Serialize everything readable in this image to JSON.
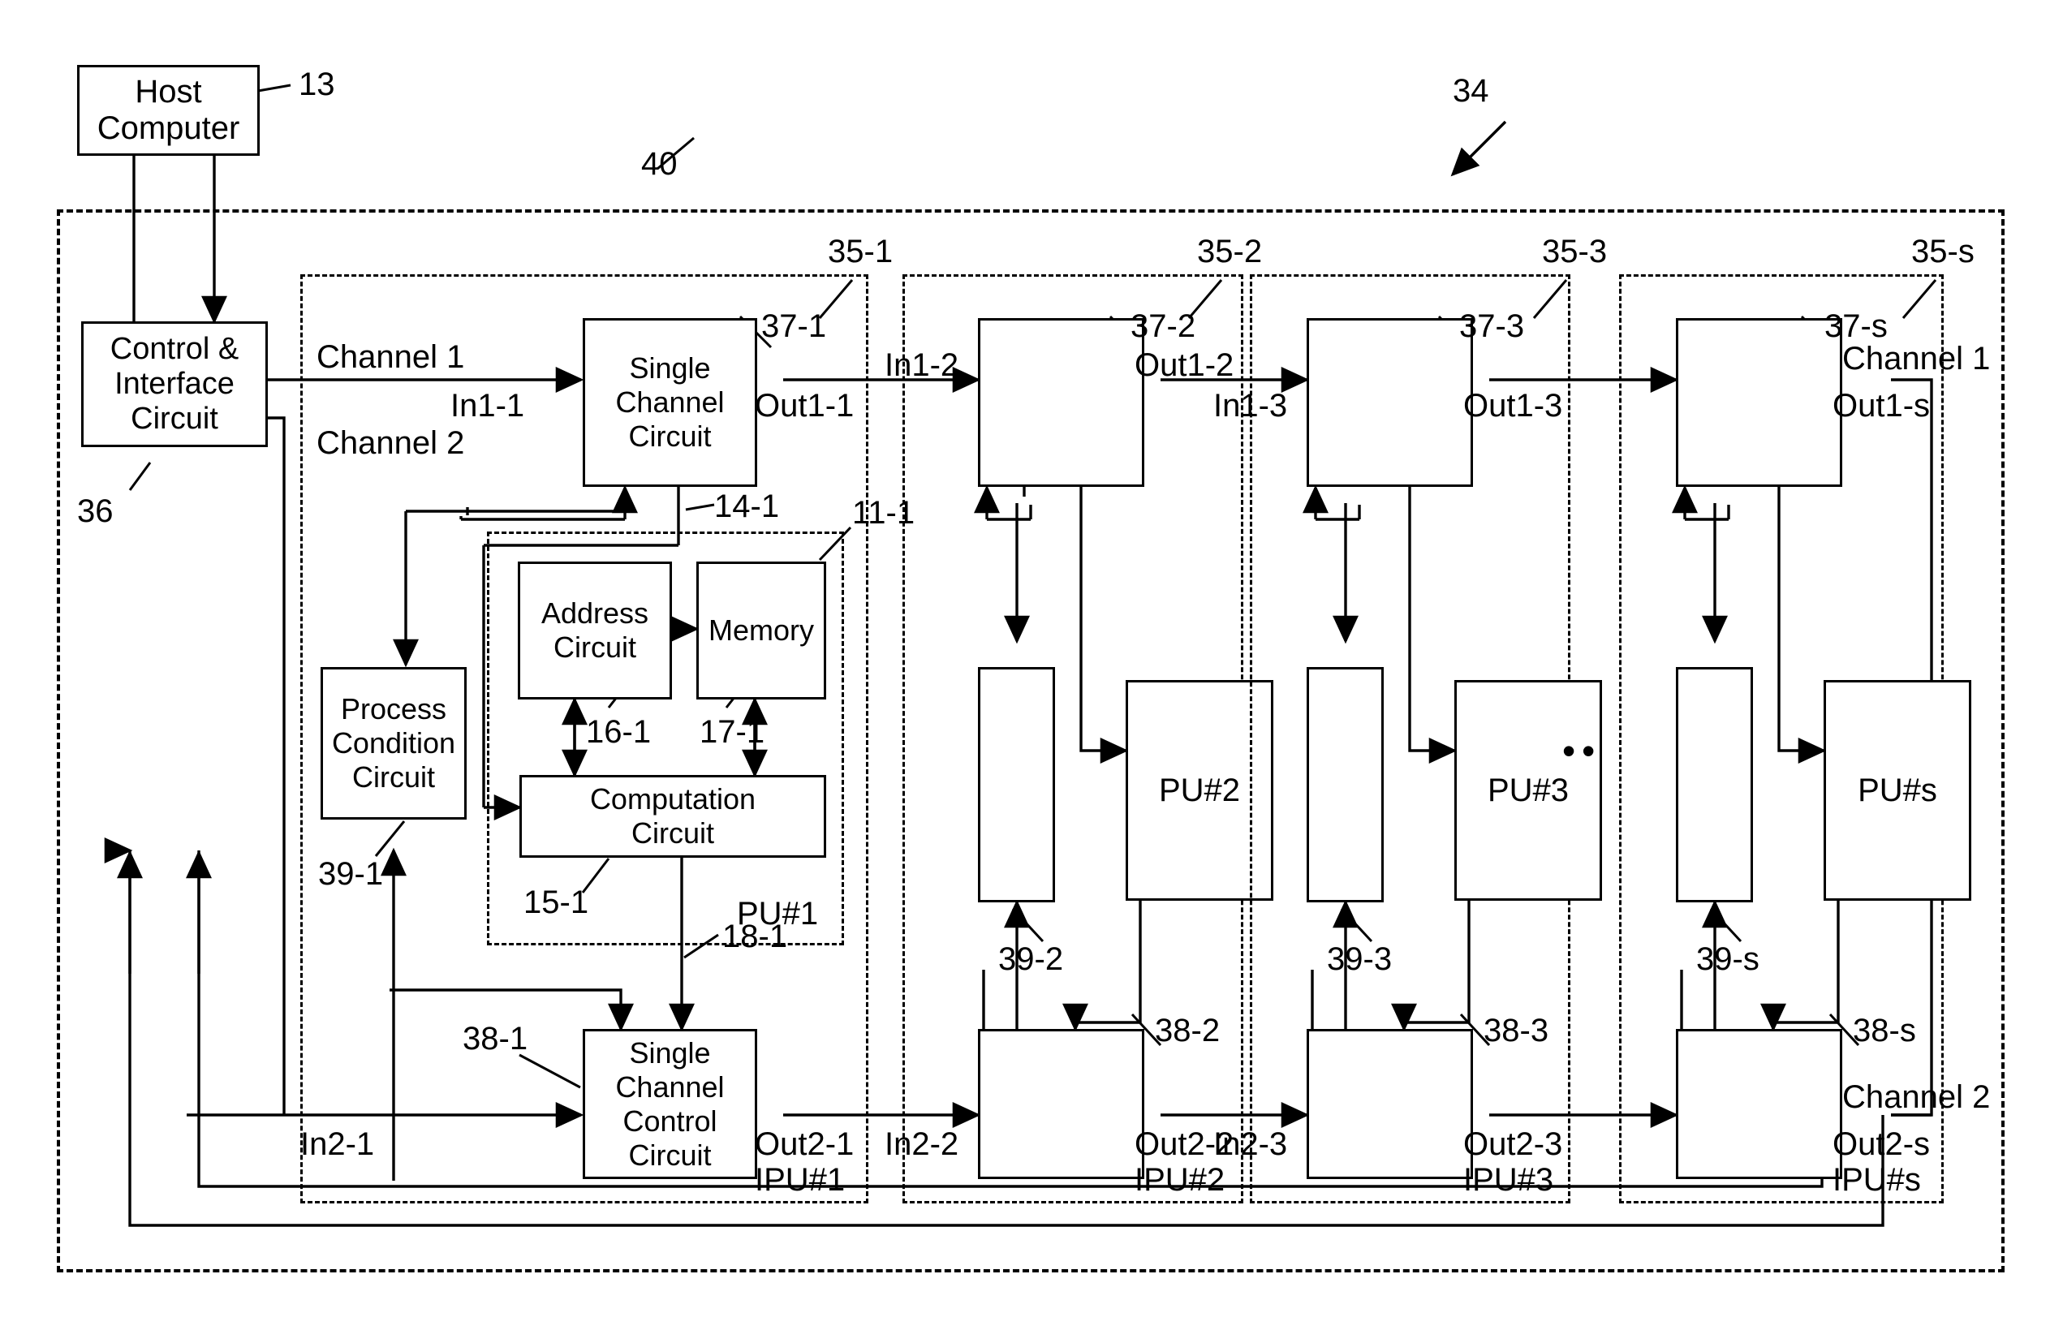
{
  "figure": {
    "overall_ref": "34",
    "system_ref": "40",
    "host": {
      "line1": "Host",
      "line2": "Computer",
      "ref": "13"
    },
    "control": {
      "line1": "Control &",
      "line2": "Interface",
      "line3": "Circuit",
      "ref": "36"
    }
  },
  "ipus": [
    {
      "id": "IPU#1",
      "outer_ref": "35-1",
      "top_box": {
        "line1": "Single",
        "line2": "Channel",
        "line3": "Circuit",
        "ref": "37-1"
      },
      "bottom_box": {
        "line1": "Single",
        "line2": "Channel",
        "line3": "Control",
        "line4": "Circuit",
        "ref": "38-1"
      },
      "pcc": {
        "line1": "Process",
        "line2": "Condition",
        "line3": "Circuit",
        "ref": "39-1"
      },
      "pu": {
        "label": "PU#1",
        "ref": "11-1"
      },
      "address": {
        "line1": "Address",
        "line2": "Circuit"
      },
      "memory": {
        "label": "Memory"
      },
      "computation": {
        "line1": "Computation",
        "line2": "Circuit",
        "ref": "15-1"
      },
      "link_addr_ref": "16-1",
      "link_mem_ref": "17-1",
      "link_ctrl_ref": "14-1",
      "link_out_ref": "18-1",
      "in1": "In1-1",
      "out1": "Out1-1",
      "in2": "In2-1",
      "out2": "Out2-1",
      "channel1": "Channel 1",
      "channel2": "Channel 2"
    },
    {
      "id": "IPU#2",
      "outer_ref": "35-2",
      "top_box": {
        "ref": "37-2"
      },
      "bottom_box": {
        "ref": "38-2"
      },
      "pcc": {
        "ref": "39-2"
      },
      "pu": {
        "label": "PU#2"
      },
      "in1": "In1-2",
      "out1": "Out1-2",
      "in2": "In2-2",
      "out2": "Out2-2"
    },
    {
      "id": "IPU#3",
      "outer_ref": "35-3",
      "top_box": {
        "ref": "37-3"
      },
      "bottom_box": {
        "ref": "38-3"
      },
      "pcc": {
        "ref": "39-3"
      },
      "pu": {
        "label": "PU#3"
      },
      "in1": "In1-3",
      "out1": "Out1-3",
      "in2": "In2-3",
      "out2": "Out2-3"
    },
    {
      "id": "IPU#s",
      "outer_ref": "35-s",
      "top_box": {
        "ref": "37-s"
      },
      "bottom_box": {
        "ref": "38-s"
      },
      "pcc": {
        "ref": "39-s"
      },
      "pu": {
        "label": "PU#s"
      },
      "out1": "Out1-s",
      "out2": "Out2-s",
      "channel1": "Channel 1",
      "channel2": "Channel 2"
    }
  ],
  "ellipsis": "••",
  "colors": {
    "ink": "#000000",
    "paper": "#ffffff"
  }
}
